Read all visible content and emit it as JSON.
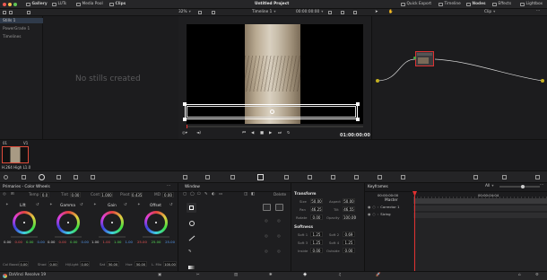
{
  "topbar": {
    "left_items": [
      {
        "label": "Gallery",
        "icon": "gallery-icon"
      },
      {
        "label": "LUTs",
        "icon": "lut-icon"
      },
      {
        "label": "Media Pool",
        "icon": "media-pool-icon"
      },
      {
        "label": "Clips",
        "icon": "clips-icon"
      }
    ],
    "title": "Untitled Project",
    "right_items": [
      {
        "label": "Quick Export",
        "icon": "export-icon"
      },
      {
        "label": "Timeline",
        "icon": "timeline-icon"
      },
      {
        "label": "Nodes",
        "icon": "nodes-icon"
      },
      {
        "label": "Effects",
        "icon": "effects-icon"
      },
      {
        "label": "Lightbox",
        "icon": "lightbox-icon"
      }
    ],
    "traffic": [
      "#ee5a52",
      "#f5bd4f",
      "#60c454"
    ]
  },
  "bar2": {
    "zoom": "32%",
    "timeline": "Timeline 1",
    "timecode": "00:00:00:00",
    "node_mode": "Clip"
  },
  "left_panel": {
    "items": [
      "Stills 1",
      "PowerGrade 1",
      "Timelines"
    ]
  },
  "gallery": {
    "empty_text": "No stills created"
  },
  "viewer": {
    "timecode": "01:00:00:00"
  },
  "clip": {
    "number": "01",
    "track": "V1",
    "codec": "H.264 High L1.0"
  },
  "primaries": {
    "title": "Primaries - Color Wheels",
    "params": [
      {
        "label": "Temp",
        "value": "0.0"
      },
      {
        "label": "Tint",
        "value": "0.00"
      },
      {
        "label": "Cont",
        "value": "1.000"
      },
      {
        "label": "Pivot",
        "value": "0.435"
      },
      {
        "label": "MD",
        "value": "0.00"
      }
    ],
    "wheels": [
      {
        "name": "Lift",
        "values": [
          "0.00",
          "0.00",
          "0.00",
          "0.00"
        ]
      },
      {
        "name": "Gamma",
        "values": [
          "0.00",
          "0.00",
          "0.00",
          "0.00"
        ]
      },
      {
        "name": "Gain",
        "values": [
          "1.00",
          "1.00",
          "1.00",
          "1.00"
        ]
      },
      {
        "name": "Offset",
        "values": [
          "25.00",
          "25.00",
          "25.00"
        ]
      }
    ],
    "bottom_params": [
      {
        "label": "Col Boost",
        "value": "0.00"
      },
      {
        "label": "Shad",
        "value": "0.00"
      },
      {
        "label": "Hi/Light",
        "value": "0.00"
      },
      {
        "label": "Sat",
        "value": "50.00"
      },
      {
        "label": "Hue",
        "value": "50.00"
      },
      {
        "label": "L. Mix",
        "value": "100.00"
      }
    ]
  },
  "window": {
    "title": "Window",
    "delete_label": "Delete"
  },
  "transform": {
    "title": "Transform",
    "rows": [
      [
        {
          "label": "Size",
          "value": "50.00"
        },
        {
          "label": "Aspect",
          "value": "50.00"
        }
      ],
      [
        {
          "label": "Pan",
          "value": "46.25"
        },
        {
          "label": "Tilt",
          "value": "46.55"
        }
      ],
      [
        {
          "label": "Rotate",
          "value": "0.00"
        },
        {
          "label": "Opacity",
          "value": "100.00"
        }
      ]
    ],
    "softness_title": "Softness",
    "soft_rows": [
      [
        {
          "label": "Soft 1",
          "value": "1.25"
        },
        {
          "label": "Soft 2",
          "value": "0.69"
        }
      ],
      [
        {
          "label": "Soft 3",
          "value": "1.25"
        },
        {
          "label": "Soft 4",
          "value": "1.25"
        }
      ],
      [
        {
          "label": "Inside",
          "value": "0.00"
        },
        {
          "label": "Outside",
          "value": "0.00"
        }
      ]
    ]
  },
  "keyframes": {
    "title": "Keyframes",
    "filter": "All",
    "timecode_left": "00:00:00:00",
    "timecode_right": "00:00:04:04",
    "tracks": [
      "Master",
      "Corrector 1",
      "Sizing"
    ]
  },
  "bottom": {
    "app_name": "DaVinci Resolve 19"
  }
}
